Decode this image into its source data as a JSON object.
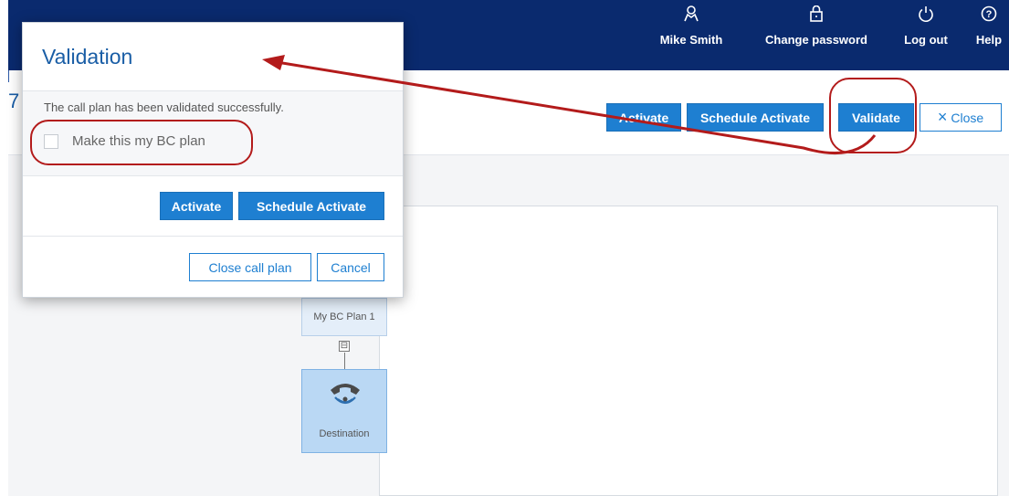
{
  "header": {
    "items": [
      {
        "label": "Mike Smith",
        "icon": "user-icon"
      },
      {
        "label": "Change password",
        "icon": "lock-icon"
      },
      {
        "label": "Log out",
        "icon": "power-icon"
      },
      {
        "label": "Help",
        "icon": "help-icon"
      }
    ]
  },
  "page": {
    "title_fragment": "7"
  },
  "toolbar": {
    "activate": "Activate",
    "schedule_activate": "Schedule Activate",
    "validate": "Validate",
    "close": "Close"
  },
  "dialog": {
    "title": "Validation",
    "message": "The call plan has been validated successfully.",
    "checkbox_label": "Make this my BC plan",
    "checkbox_checked": false,
    "activate": "Activate",
    "schedule_activate": "Schedule Activate",
    "close_call_plan": "Close call plan",
    "cancel": "Cancel"
  },
  "diagram": {
    "plan_node": "My BC Plan 1",
    "collapse_symbol": "⊟",
    "destination_node": "Destination"
  },
  "colors": {
    "header_bg": "#0a2a6e",
    "primary": "#1e7fd1",
    "annotation": "#b31b1b",
    "title": "#1a5ea6"
  }
}
